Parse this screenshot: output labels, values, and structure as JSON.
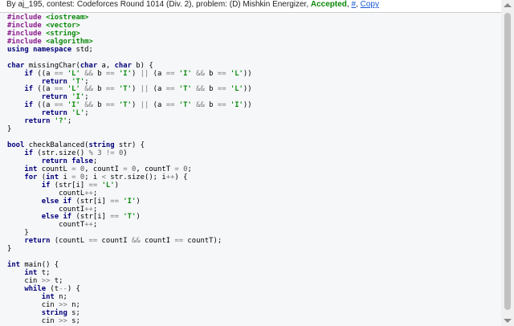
{
  "header": {
    "prefix": "By aj_195, contest: Codeforces Round 1014 (Div. 2), problem: (D) Mishkin Energizer, ",
    "verdict": "Accepted",
    "sep1": ", ",
    "hash_link": "#",
    "sep2": ", ",
    "copy_link": "Copy"
  },
  "code_lines": [
    "#include <iostream>",
    "#include <vector>",
    "#include <string>",
    "#include <algorithm>",
    "using namespace std;",
    "",
    "char missingChar(char a, char b) {",
    "    if ((a == 'L' && b == 'I') || (a == 'I' && b == 'L'))",
    "        return 'T';",
    "    if ((a == 'L' && b == 'T') || (a == 'T' && b == 'L'))",
    "        return 'I';",
    "    if ((a == 'I' && b == 'T') || (a == 'T' && b == 'I'))",
    "        return 'L';",
    "    return '?';",
    "}",
    "",
    "bool checkBalanced(string str) {",
    "    if (str.size() % 3 != 0)",
    "        return false;",
    "    int countL = 0, countI = 0, countT = 0;",
    "    for (int i = 0; i < str.size(); i++) {",
    "        if (str[i] == 'L')",
    "            countL++;",
    "        else if (str[i] == 'I')",
    "            countI++;",
    "        else if (str[i] == 'T')",
    "            countT++;",
    "    }",
    "    return (countL == countI && countI == countT);",
    "}",
    "",
    "int main() {",
    "    int t;",
    "    cin >> t;",
    "    while (t--) {",
    "        int n;",
    "        cin >> n;",
    "        string s;",
    "        cin >> s;"
  ],
  "colors": {
    "accepted": "#0a8a0a",
    "link": "#1a5ad6",
    "code_background": "#f6f7f9",
    "keyword": "#00007a",
    "string": "#0a8a0a",
    "preprocessor": "#8b1a8b"
  }
}
